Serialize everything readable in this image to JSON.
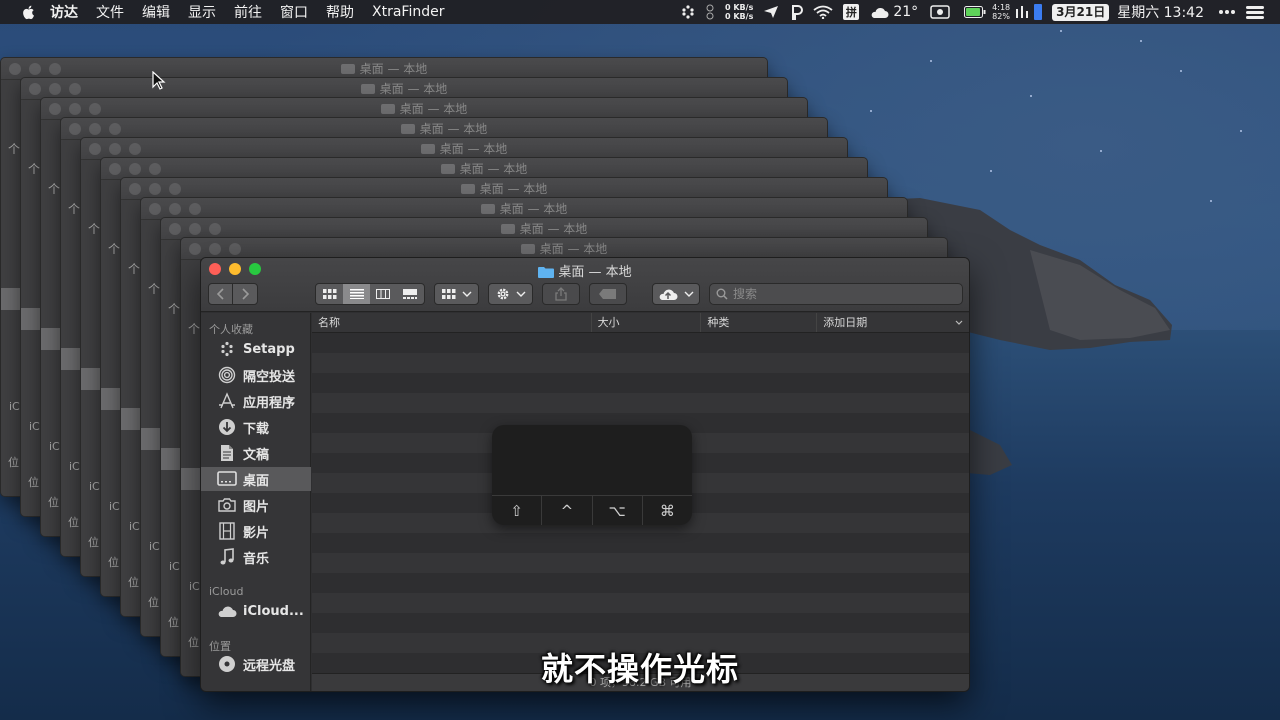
{
  "menubar": {
    "items": [
      "访达",
      "文件",
      "编辑",
      "显示",
      "前往",
      "窗口",
      "帮助",
      "XtraFinder"
    ],
    "net_up": "0 KB/s",
    "net_down": "0 KB/s",
    "weather_temp": "21°",
    "battery_time": "4:18",
    "battery_pct": "82%",
    "date": "3月21日",
    "clock": "星期六 13:42"
  },
  "ghost_windows": {
    "title": "桌面 — 本地",
    "up_glyph": "个",
    "icloud_abbr": "iC",
    "location_abbr": "位"
  },
  "window": {
    "title": "桌面 — 本地",
    "search_placeholder": "搜索",
    "status": "0 项，58.2 GB 可用"
  },
  "sidebar": {
    "favorites_header": "个人收藏",
    "favorites": [
      {
        "label": "Setapp",
        "icon": "setapp-icon"
      },
      {
        "label": "隔空投送",
        "icon": "airdrop-icon"
      },
      {
        "label": "应用程序",
        "icon": "applications-icon"
      },
      {
        "label": "下载",
        "icon": "download-icon"
      },
      {
        "label": "文稿",
        "icon": "documents-icon"
      },
      {
        "label": "桌面",
        "icon": "desktop-icon",
        "active": true
      },
      {
        "label": "图片",
        "icon": "camera-icon"
      },
      {
        "label": "影片",
        "icon": "film-icon"
      },
      {
        "label": "音乐",
        "icon": "music-icon"
      }
    ],
    "icloud_header": "iCloud",
    "icloud_item": "iCloud...",
    "locations_header": "位置",
    "location_item": "远程光盘"
  },
  "columns": [
    "名称",
    "大小",
    "种类",
    "添加日期"
  ],
  "keyboard_overlay": {
    "keys": [
      "⇧",
      "^",
      "⌥",
      "⌘"
    ]
  },
  "subtitle": "就不操作光标",
  "colors": {
    "close": "#fe5f57",
    "minimize": "#febc2e",
    "maximize": "#28c840",
    "folder_blue": "#5fb3f0"
  }
}
